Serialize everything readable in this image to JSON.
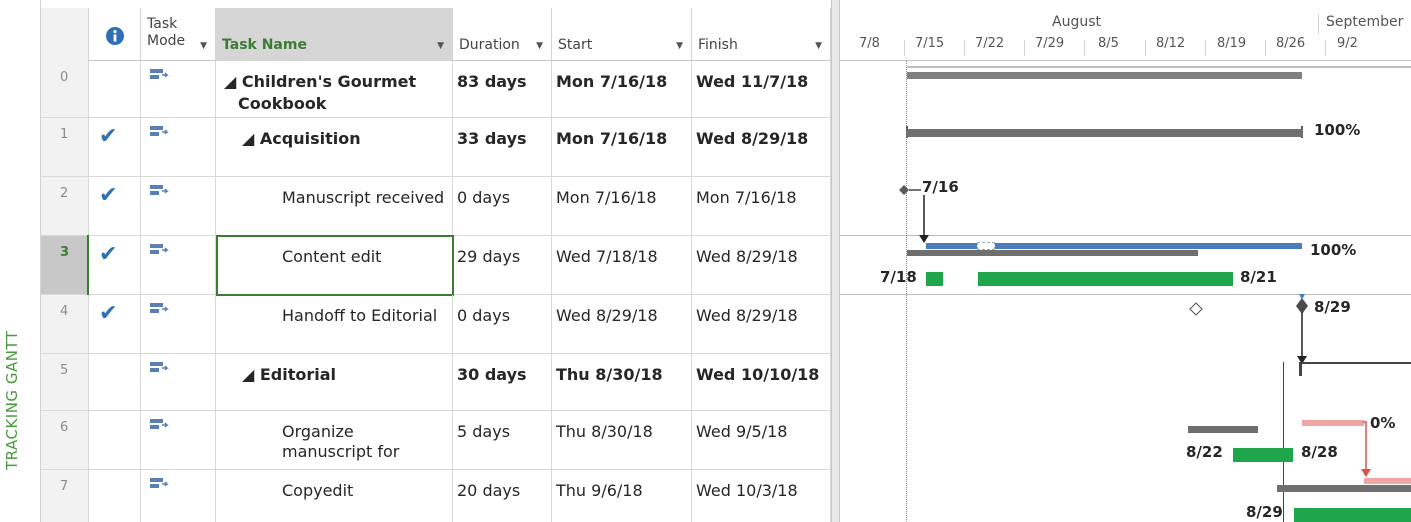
{
  "view_label": "TRACKING GANTT",
  "columns": {
    "info_icon": "info-icon",
    "task_mode": "Task Mode",
    "task_name": "Task Name",
    "duration": "Duration",
    "start": "Start",
    "finish": "Finish"
  },
  "timeline": {
    "months": [
      "August",
      "September"
    ],
    "weeks": [
      "7/8",
      "7/15",
      "7/22",
      "7/29",
      "8/5",
      "8/12",
      "8/19",
      "8/26",
      "9/2"
    ]
  },
  "rows": [
    {
      "id": "0",
      "complete": false,
      "name_a": "◢ Children's Gourmet",
      "name_b": "Cookbook",
      "duration": "83 days",
      "start": "Mon 7/16/18",
      "finish": "Wed 11/7/18",
      "summary": true
    },
    {
      "id": "1",
      "complete": true,
      "name_a": "◢ Acquisition",
      "duration": "33 days",
      "start": "Mon 7/16/18",
      "finish": "Wed 8/29/18",
      "summary": true
    },
    {
      "id": "2",
      "complete": true,
      "name_a": "Manuscript received",
      "duration": "0 days",
      "start": "Mon 7/16/18",
      "finish": "Mon 7/16/18"
    },
    {
      "id": "3",
      "complete": true,
      "name_a": "Content edit",
      "duration": "29 days",
      "start": "Wed 7/18/18",
      "finish": "Wed 8/29/18",
      "selected": true
    },
    {
      "id": "4",
      "complete": true,
      "name_a": "Handoff to Editorial",
      "duration": "0 days",
      "start": "Wed 8/29/18",
      "finish": "Wed 8/29/18"
    },
    {
      "id": "5",
      "complete": false,
      "name_a": "◢ Editorial",
      "duration": "30 days",
      "start": "Thu 8/30/18",
      "finish": "Wed 10/10/18",
      "summary": true
    },
    {
      "id": "6",
      "complete": false,
      "name_a": "Organize",
      "name_b": "manuscript for",
      "duration": "5 days",
      "start": "Thu 8/30/18",
      "finish": "Wed 9/5/18"
    },
    {
      "id": "7",
      "complete": false,
      "name_a": "Copyedit",
      "duration": "20 days",
      "start": "Thu 9/6/18",
      "finish": "Wed 10/3/18"
    }
  ],
  "gantt_labels": {
    "r1_pct": "100%",
    "r2_date": "7/16",
    "r3_pct": "100%",
    "r3_left": "7/18",
    "r3_right": "8/21",
    "r4_date": "8/29",
    "r6_pct": "0%",
    "r6_left": "8/22",
    "r6_right": "8/28",
    "r7_left": "8/29"
  },
  "colors": {
    "accent_green": "#3a7d32",
    "progress_blue": "#4a7ebb",
    "baseline_gray": "#707070",
    "actual_green": "#1fa64a",
    "critical_red": "#f0a5a5",
    "check_blue": "#2f6fb5"
  }
}
